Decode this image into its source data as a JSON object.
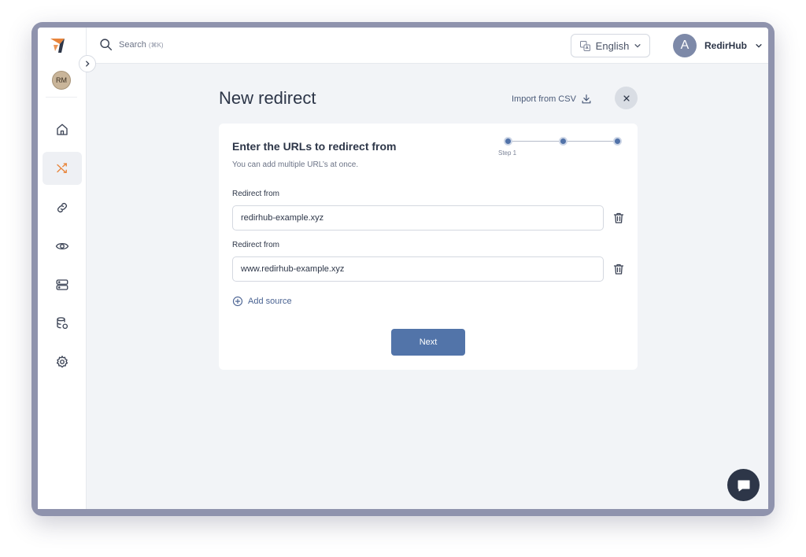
{
  "sidebar": {
    "avatar_initials": "RM",
    "items": [
      {
        "icon": "home-icon",
        "active": false
      },
      {
        "icon": "shuffle-icon",
        "active": true
      },
      {
        "icon": "link-icon",
        "active": false
      },
      {
        "icon": "eye-icon",
        "active": false
      },
      {
        "icon": "server-icon",
        "active": false
      },
      {
        "icon": "database-icon",
        "active": false
      },
      {
        "icon": "gear-icon",
        "active": false
      }
    ]
  },
  "topbar": {
    "search_placeholder": "Search",
    "search_shortcut": "(⌘K)",
    "language": "English",
    "user_initial": "A",
    "user_name": "RedirHub"
  },
  "main": {
    "title": "New redirect",
    "import_label": "Import from CSV",
    "card": {
      "title": "Enter the URLs to redirect from",
      "subtitle": "You can add multiple URL’s at once.",
      "step_label": "Step 1",
      "fields": [
        {
          "label": "Redirect from",
          "value": "redirhub-example.xyz"
        },
        {
          "label": "Redirect from",
          "value": "www.redirhub-example.xyz"
        }
      ],
      "add_source_label": "Add source",
      "next_label": "Next"
    }
  },
  "colors": {
    "accent": "#5274a9",
    "brand_orange": "#e8843a",
    "dark": "#2d3648"
  }
}
